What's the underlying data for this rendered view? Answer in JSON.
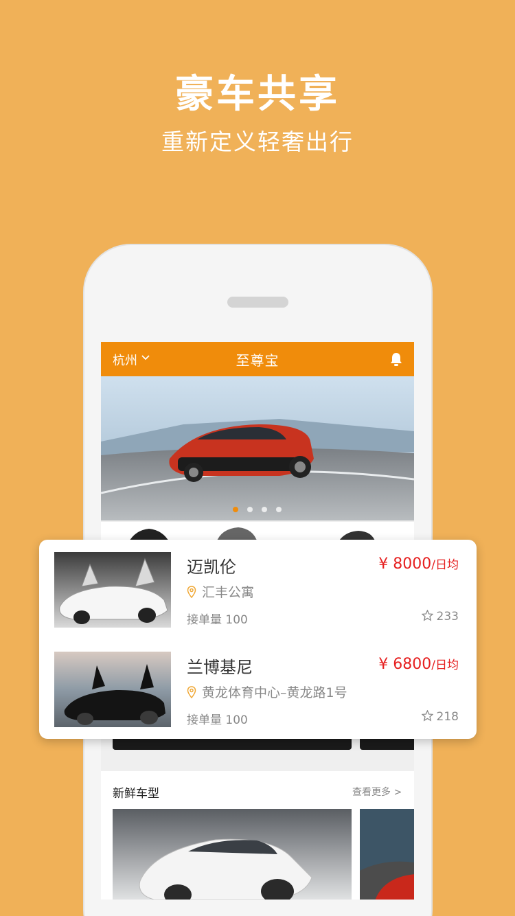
{
  "hero": {
    "title": "豪车共享",
    "subtitle": "重新定义轻奢出行"
  },
  "app": {
    "city": "杭州",
    "title": "至尊宝",
    "carousel": {
      "dots": 4,
      "active_index": 0
    }
  },
  "listings": [
    {
      "name": "迈凯伦",
      "price": "¥ 8000",
      "unit": "/日均",
      "location": "汇丰公寓",
      "orders": "接单量 100",
      "rating": "233"
    },
    {
      "name": "兰博基尼",
      "price": "¥ 6800",
      "unit": "/日均",
      "location": "黄龙体育中心–黄龙路1号",
      "orders": "接单量 100",
      "rating": "218"
    }
  ],
  "fresh": {
    "title": "新鲜车型",
    "more": "查看更多 >"
  },
  "colors": {
    "background": "#F0B158",
    "accent": "#F08C0B",
    "price": "#E62020"
  }
}
